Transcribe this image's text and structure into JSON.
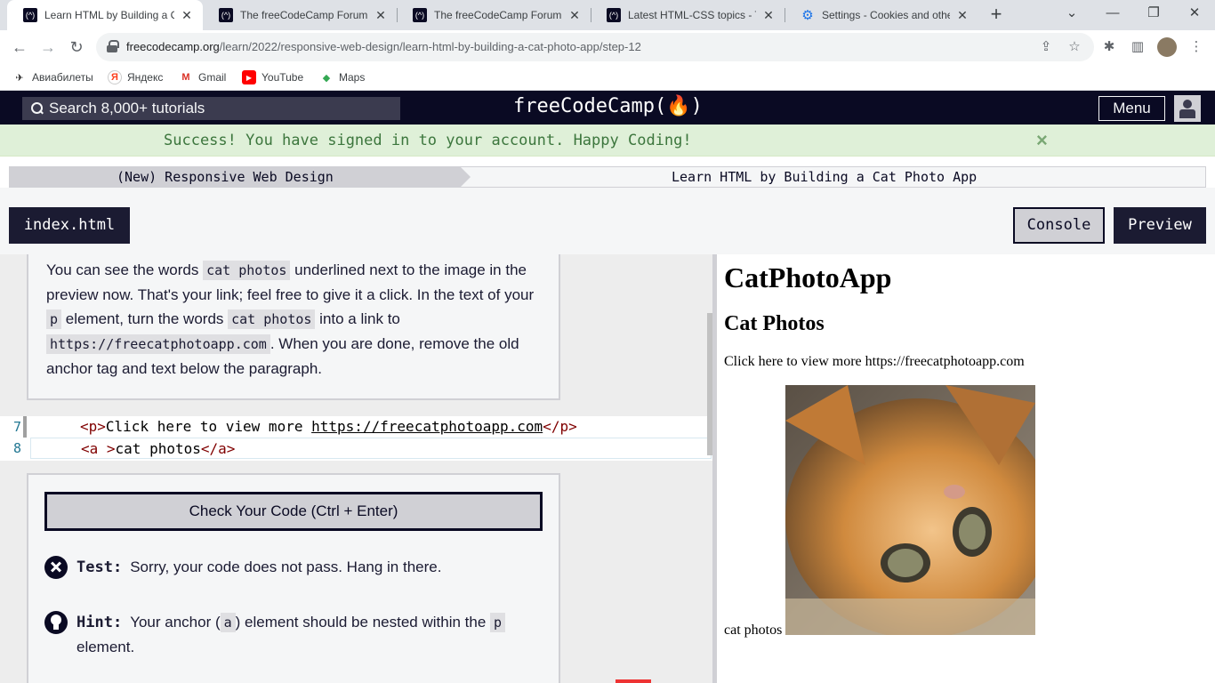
{
  "browser": {
    "tabs": [
      {
        "title": "Learn HTML by Building a Ca",
        "active": true
      },
      {
        "title": "The freeCodeCamp Forum",
        "active": false
      },
      {
        "title": "The freeCodeCamp Forum",
        "active": false
      },
      {
        "title": "Latest HTML-CSS topics - The",
        "active": false
      },
      {
        "title": "Settings - Cookies and other",
        "active": false
      }
    ],
    "url_host": "freecodecamp.org",
    "url_path": "/learn/2022/responsive-web-design/learn-html-by-building-a-cat-photo-app/step-12",
    "bookmarks": [
      "Авиабилеты",
      "Яндекс",
      "Gmail",
      "YouTube",
      "Maps"
    ]
  },
  "fcc": {
    "search_placeholder": "Search 8,000+ tutorials",
    "logo": "freeCodeCamp(🔥)",
    "menu_label": "Menu",
    "flash_message": "Success! You have signed in to your account. Happy Coding!",
    "flash_close": "×",
    "breadcrumb_left": "(New) Responsive Web Design",
    "breadcrumb_right": "Learn HTML by Building a Cat Photo App",
    "file_tab": "index.html",
    "console_label": "Console",
    "preview_label": "Preview"
  },
  "description": {
    "t1": "You can see the words ",
    "c1": "cat photos",
    "t2": " underlined next to the image in the preview now. That's your link; feel free to give it a click. In the text of your ",
    "c2": "p",
    "t3": " element, turn the words ",
    "c3": "cat photos",
    "t4": " into a link to ",
    "c4": "https://freecatphotoapp.com",
    "t5": ". When you are done, remove the old anchor tag and text below the paragraph."
  },
  "editor": {
    "lines": [
      {
        "num": "7",
        "open": "<p>",
        "text_before": "Click here to view more ",
        "link": "https://freecatphotoapp.com",
        "close": "</p>"
      },
      {
        "num": "8",
        "open": "<a >",
        "text": "cat photos",
        "close": "</a>"
      }
    ]
  },
  "tests": {
    "check_button": "Check Your Code (Ctrl + Enter)",
    "test_label": "Test:",
    "test_text": "Sorry, your code does not pass. Hang in there.",
    "hint_label": "Hint:",
    "hint_t1": "Your anchor (",
    "hint_c1": "a",
    "hint_t2": ") element should be nested within the ",
    "hint_c2": "p",
    "hint_t3": "element."
  },
  "preview": {
    "h1": "CatPhotoApp",
    "h2": "Cat Photos",
    "p": "Click here to view more https://freecatphotoapp.com",
    "link_text": "cat photos"
  }
}
